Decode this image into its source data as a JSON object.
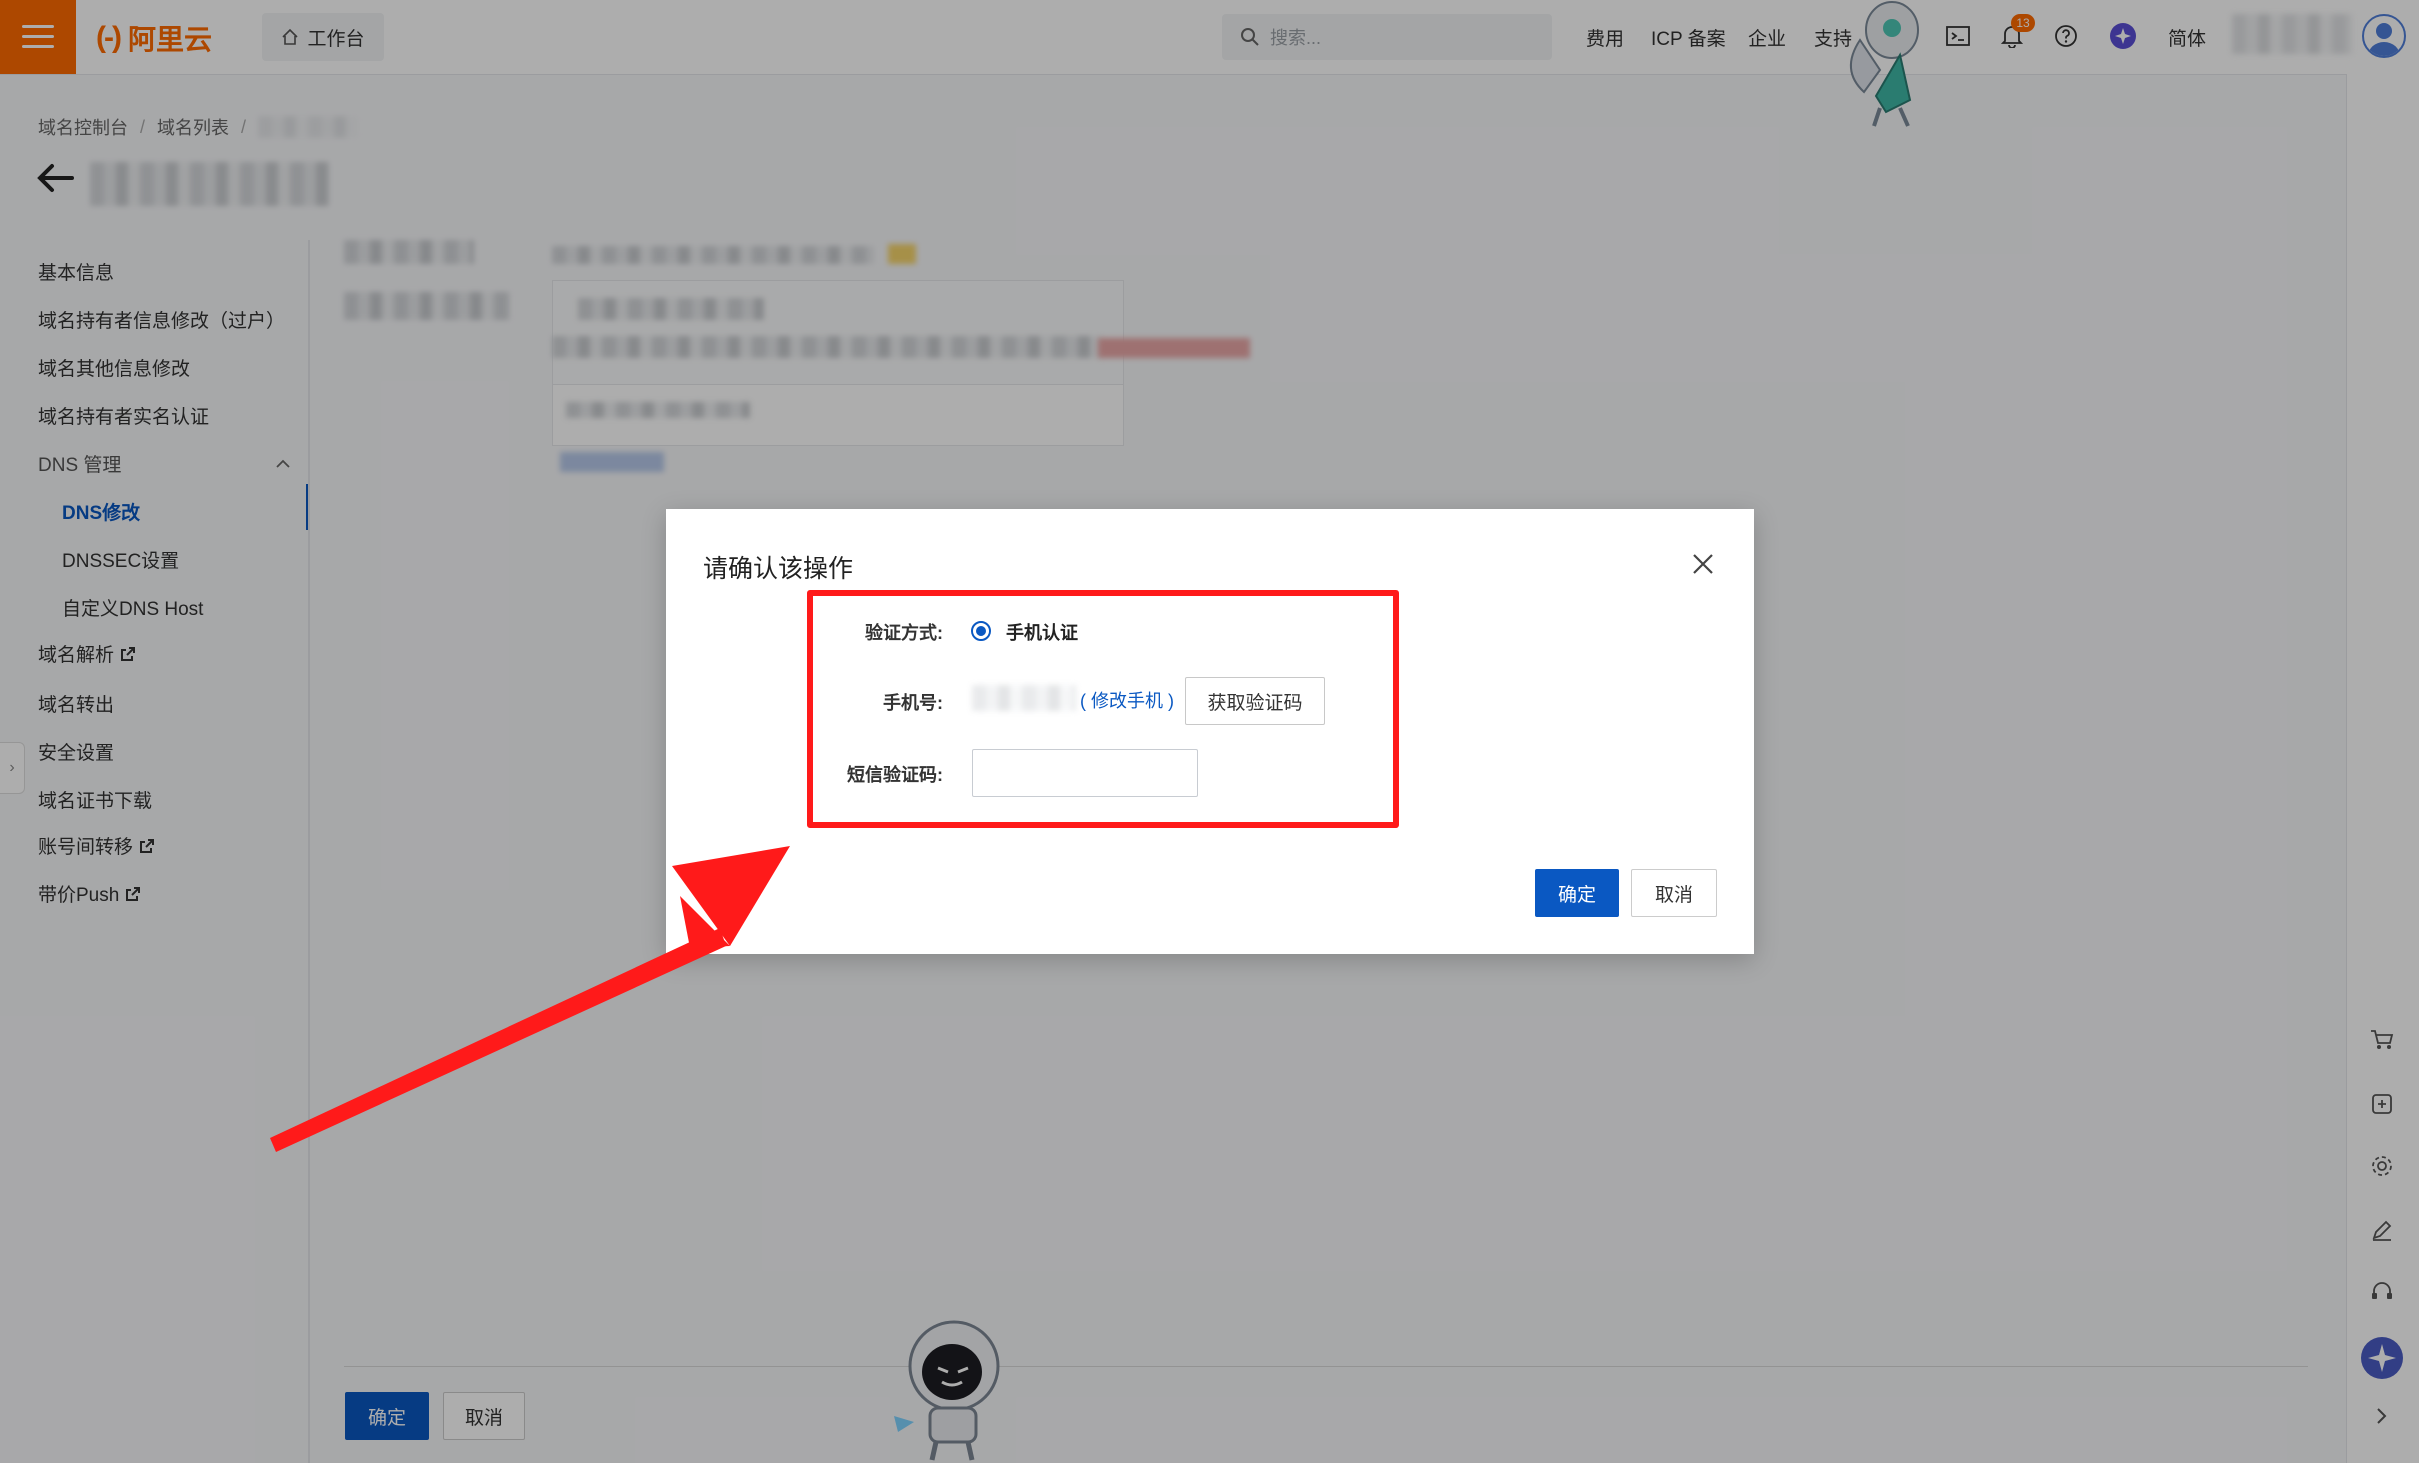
{
  "brand": {
    "name": "阿里云",
    "accent": "#ff6a00"
  },
  "topbar": {
    "workbench": "工作台",
    "search_placeholder": "搜索...",
    "links": [
      "费用",
      "ICP 备案",
      "企业",
      "支持"
    ],
    "notification_count": "13",
    "language": "简体"
  },
  "breadcrumb": [
    "域名控制台",
    "域名列表"
  ],
  "sidebar": {
    "items": [
      {
        "label": "基本信息"
      },
      {
        "label": "域名持有者信息修改（过户）"
      },
      {
        "label": "域名其他信息修改"
      },
      {
        "label": "域名持有者实名认证"
      },
      {
        "label": "DNS 管理"
      },
      {
        "label": "DNS修改"
      },
      {
        "label": "DNSSEC设置"
      },
      {
        "label": "自定义DNS Host"
      },
      {
        "label": "域名解析"
      },
      {
        "label": "域名转出"
      },
      {
        "label": "安全设置"
      },
      {
        "label": "域名证书下载"
      },
      {
        "label": "账号间转移"
      },
      {
        "label": "带价Push"
      }
    ]
  },
  "footer": {
    "ok": "确定",
    "cancel": "取消"
  },
  "dialog": {
    "title": "请确认该操作",
    "verify_label": "验证方式:",
    "verify_option": "手机认证",
    "phone_label": "手机号:",
    "change_phone": "( 修改手机 )",
    "get_code": "获取验证码",
    "sms_label": "短信验证码:",
    "sms_value": "",
    "ok": "确定",
    "cancel": "取消"
  },
  "colors": {
    "primary": "#0a58c2",
    "highlight": "#ff1a1a"
  }
}
